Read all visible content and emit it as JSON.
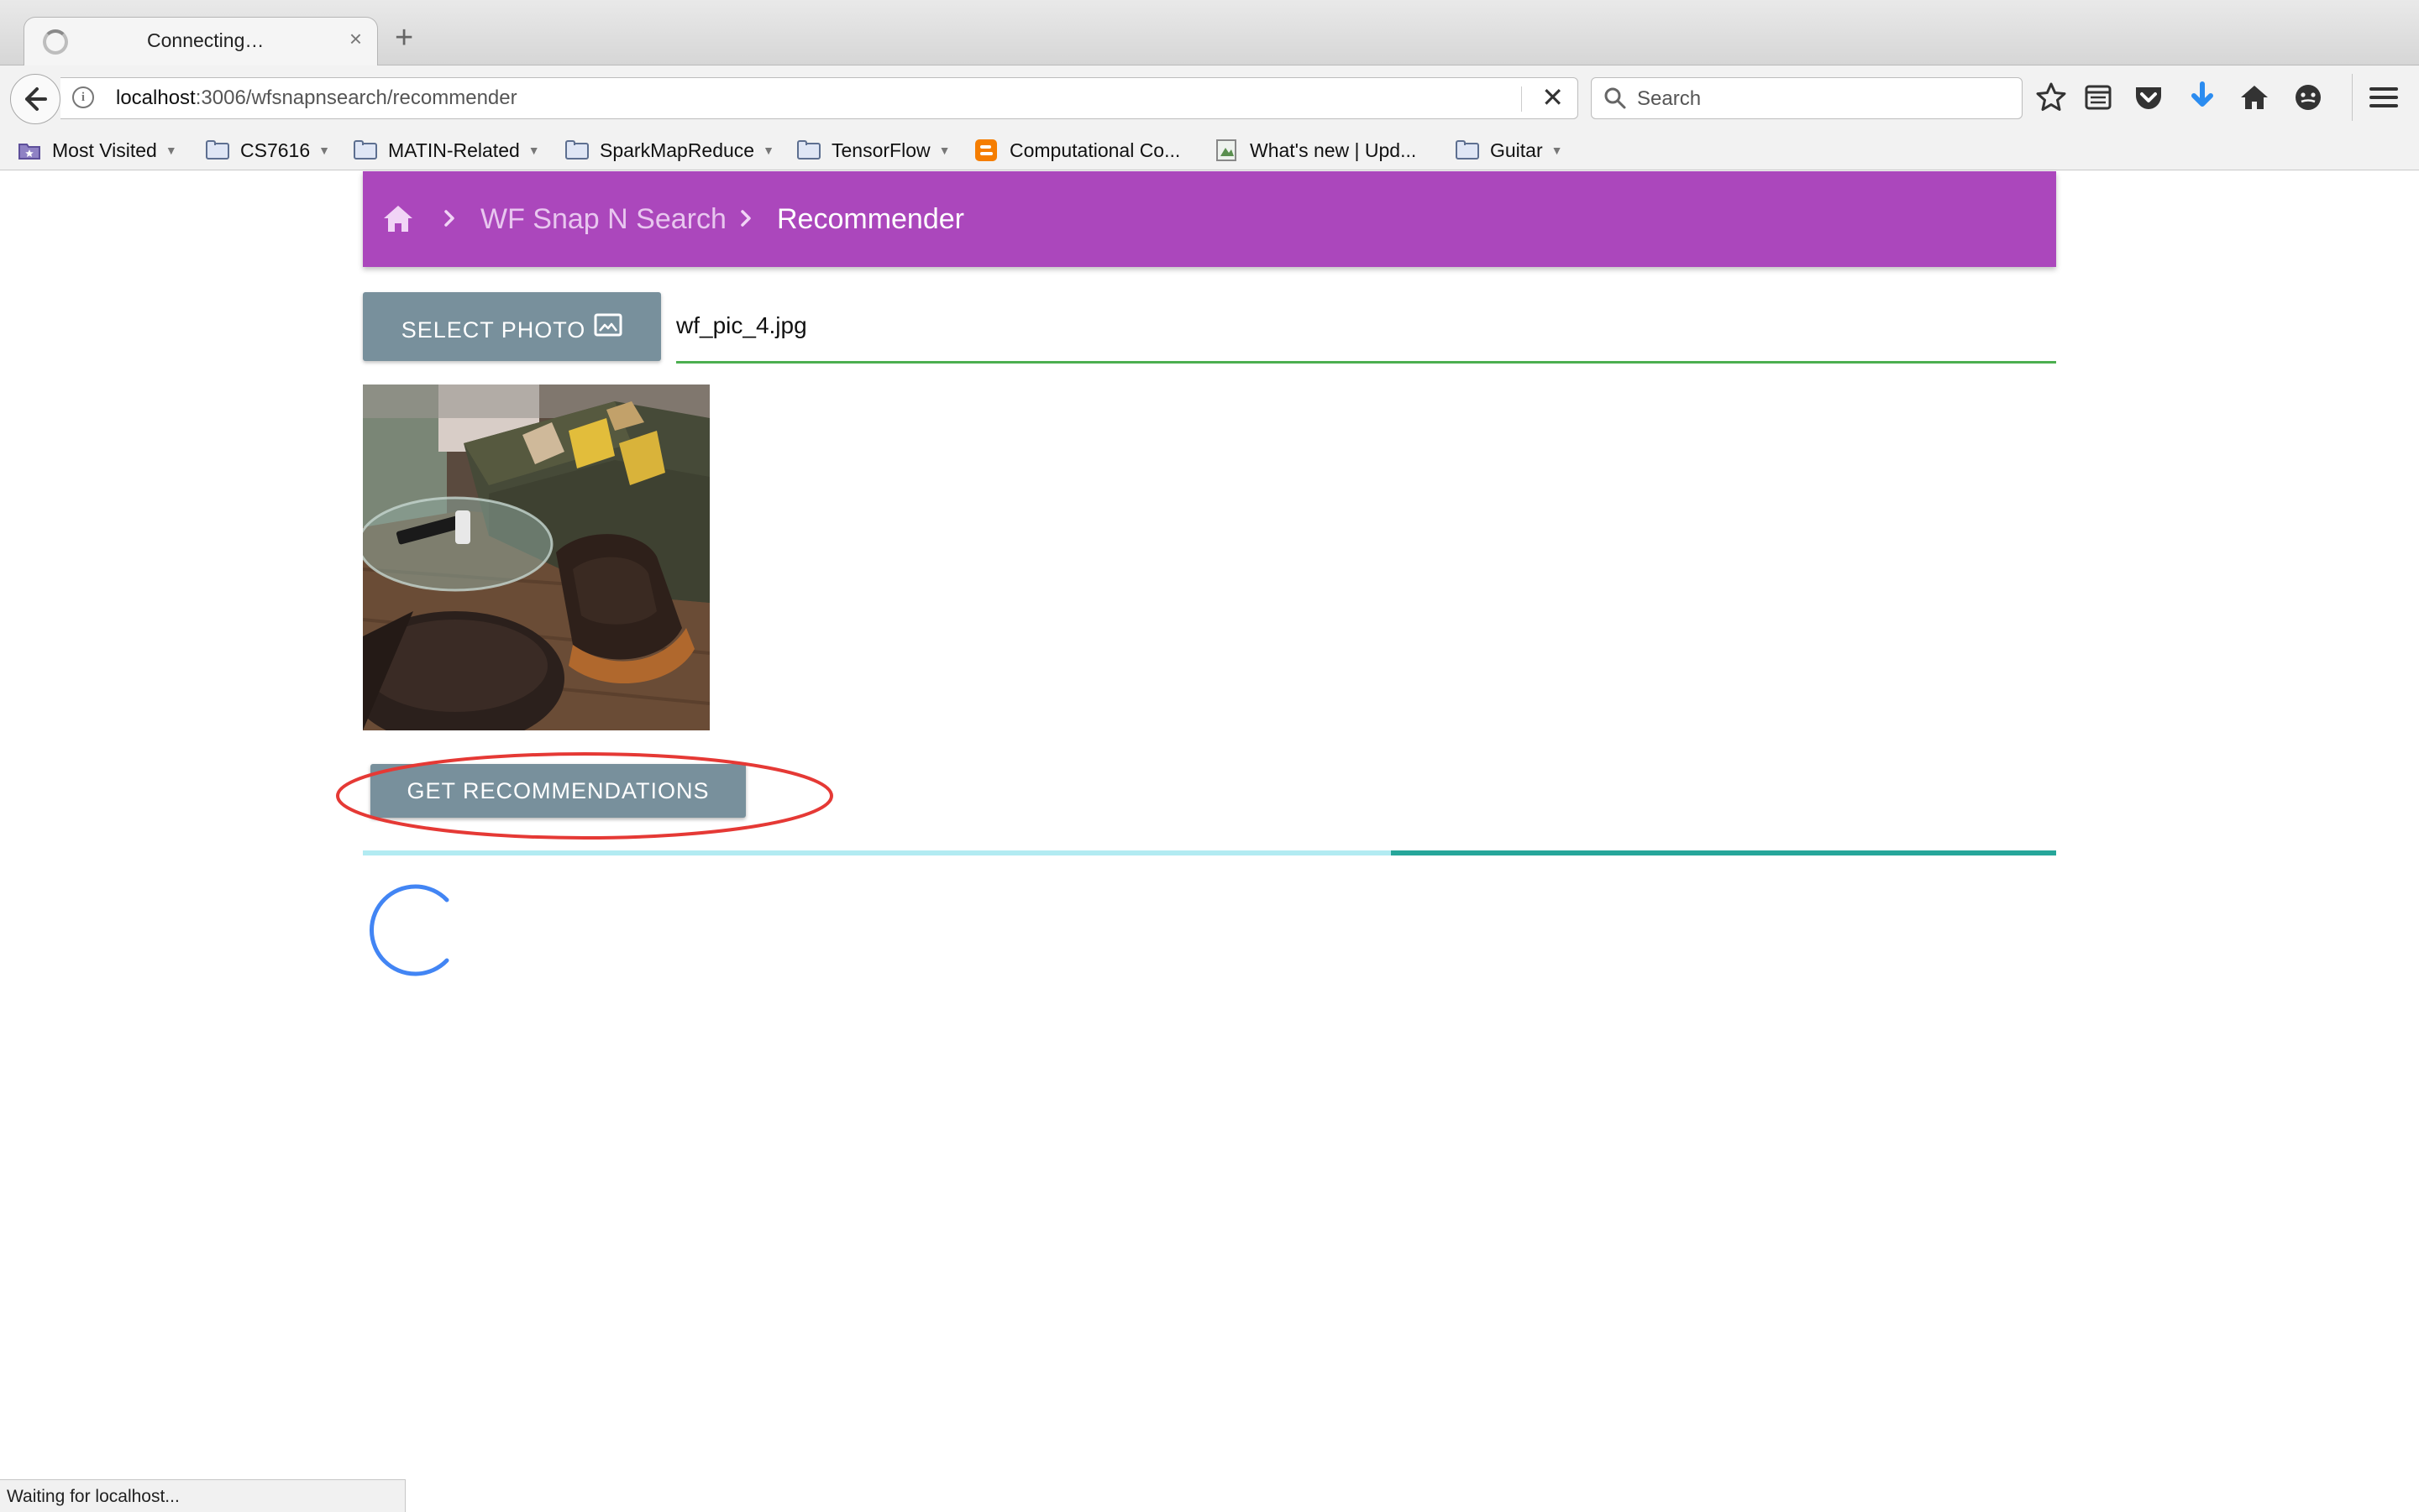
{
  "browser": {
    "tab": {
      "title": "Connecting…",
      "close": "×"
    },
    "new_tab": "+",
    "url": {
      "host": "localhost",
      "rest": ":3006/wfsnapnsearch/recommender"
    },
    "url_stop": "✕",
    "search_placeholder": "Search",
    "bookmarks": [
      {
        "label": "Most Visited",
        "icon": "most-visited-icon",
        "has_caret": true
      },
      {
        "label": "CS7616",
        "icon": "folder-icon",
        "has_caret": true
      },
      {
        "label": "MATIN-Related",
        "icon": "folder-icon",
        "has_caret": true
      },
      {
        "label": "SparkMapReduce",
        "icon": "folder-icon",
        "has_caret": true
      },
      {
        "label": "TensorFlow",
        "icon": "folder-icon",
        "has_caret": true
      },
      {
        "label": "Computational Co...",
        "icon": "blogger-icon",
        "has_caret": false
      },
      {
        "label": "What's new | Upd...",
        "icon": "page-icon",
        "has_caret": false
      },
      {
        "label": "Guitar",
        "icon": "folder-icon",
        "has_caret": true
      }
    ],
    "status": "Waiting for localhost..."
  },
  "breadcrumb": {
    "items": [
      "WF Snap N Search",
      "Recommender"
    ]
  },
  "upload": {
    "select_label": "SELECT PHOTO",
    "file_name": "wf_pic_4.jpg"
  },
  "actions": {
    "recommend_label": "GET RECOMMENDATIONS"
  },
  "progress": {
    "start_fraction": 0.607,
    "end_fraction": 1.0
  },
  "colors": {
    "header": "#ab47bc",
    "button": "#78909c",
    "underline": "#4caf50",
    "progress_track": "#b2ebf2",
    "progress_fill": "#26a69a",
    "spinner": "#4285f4",
    "highlight": "#e53935"
  }
}
